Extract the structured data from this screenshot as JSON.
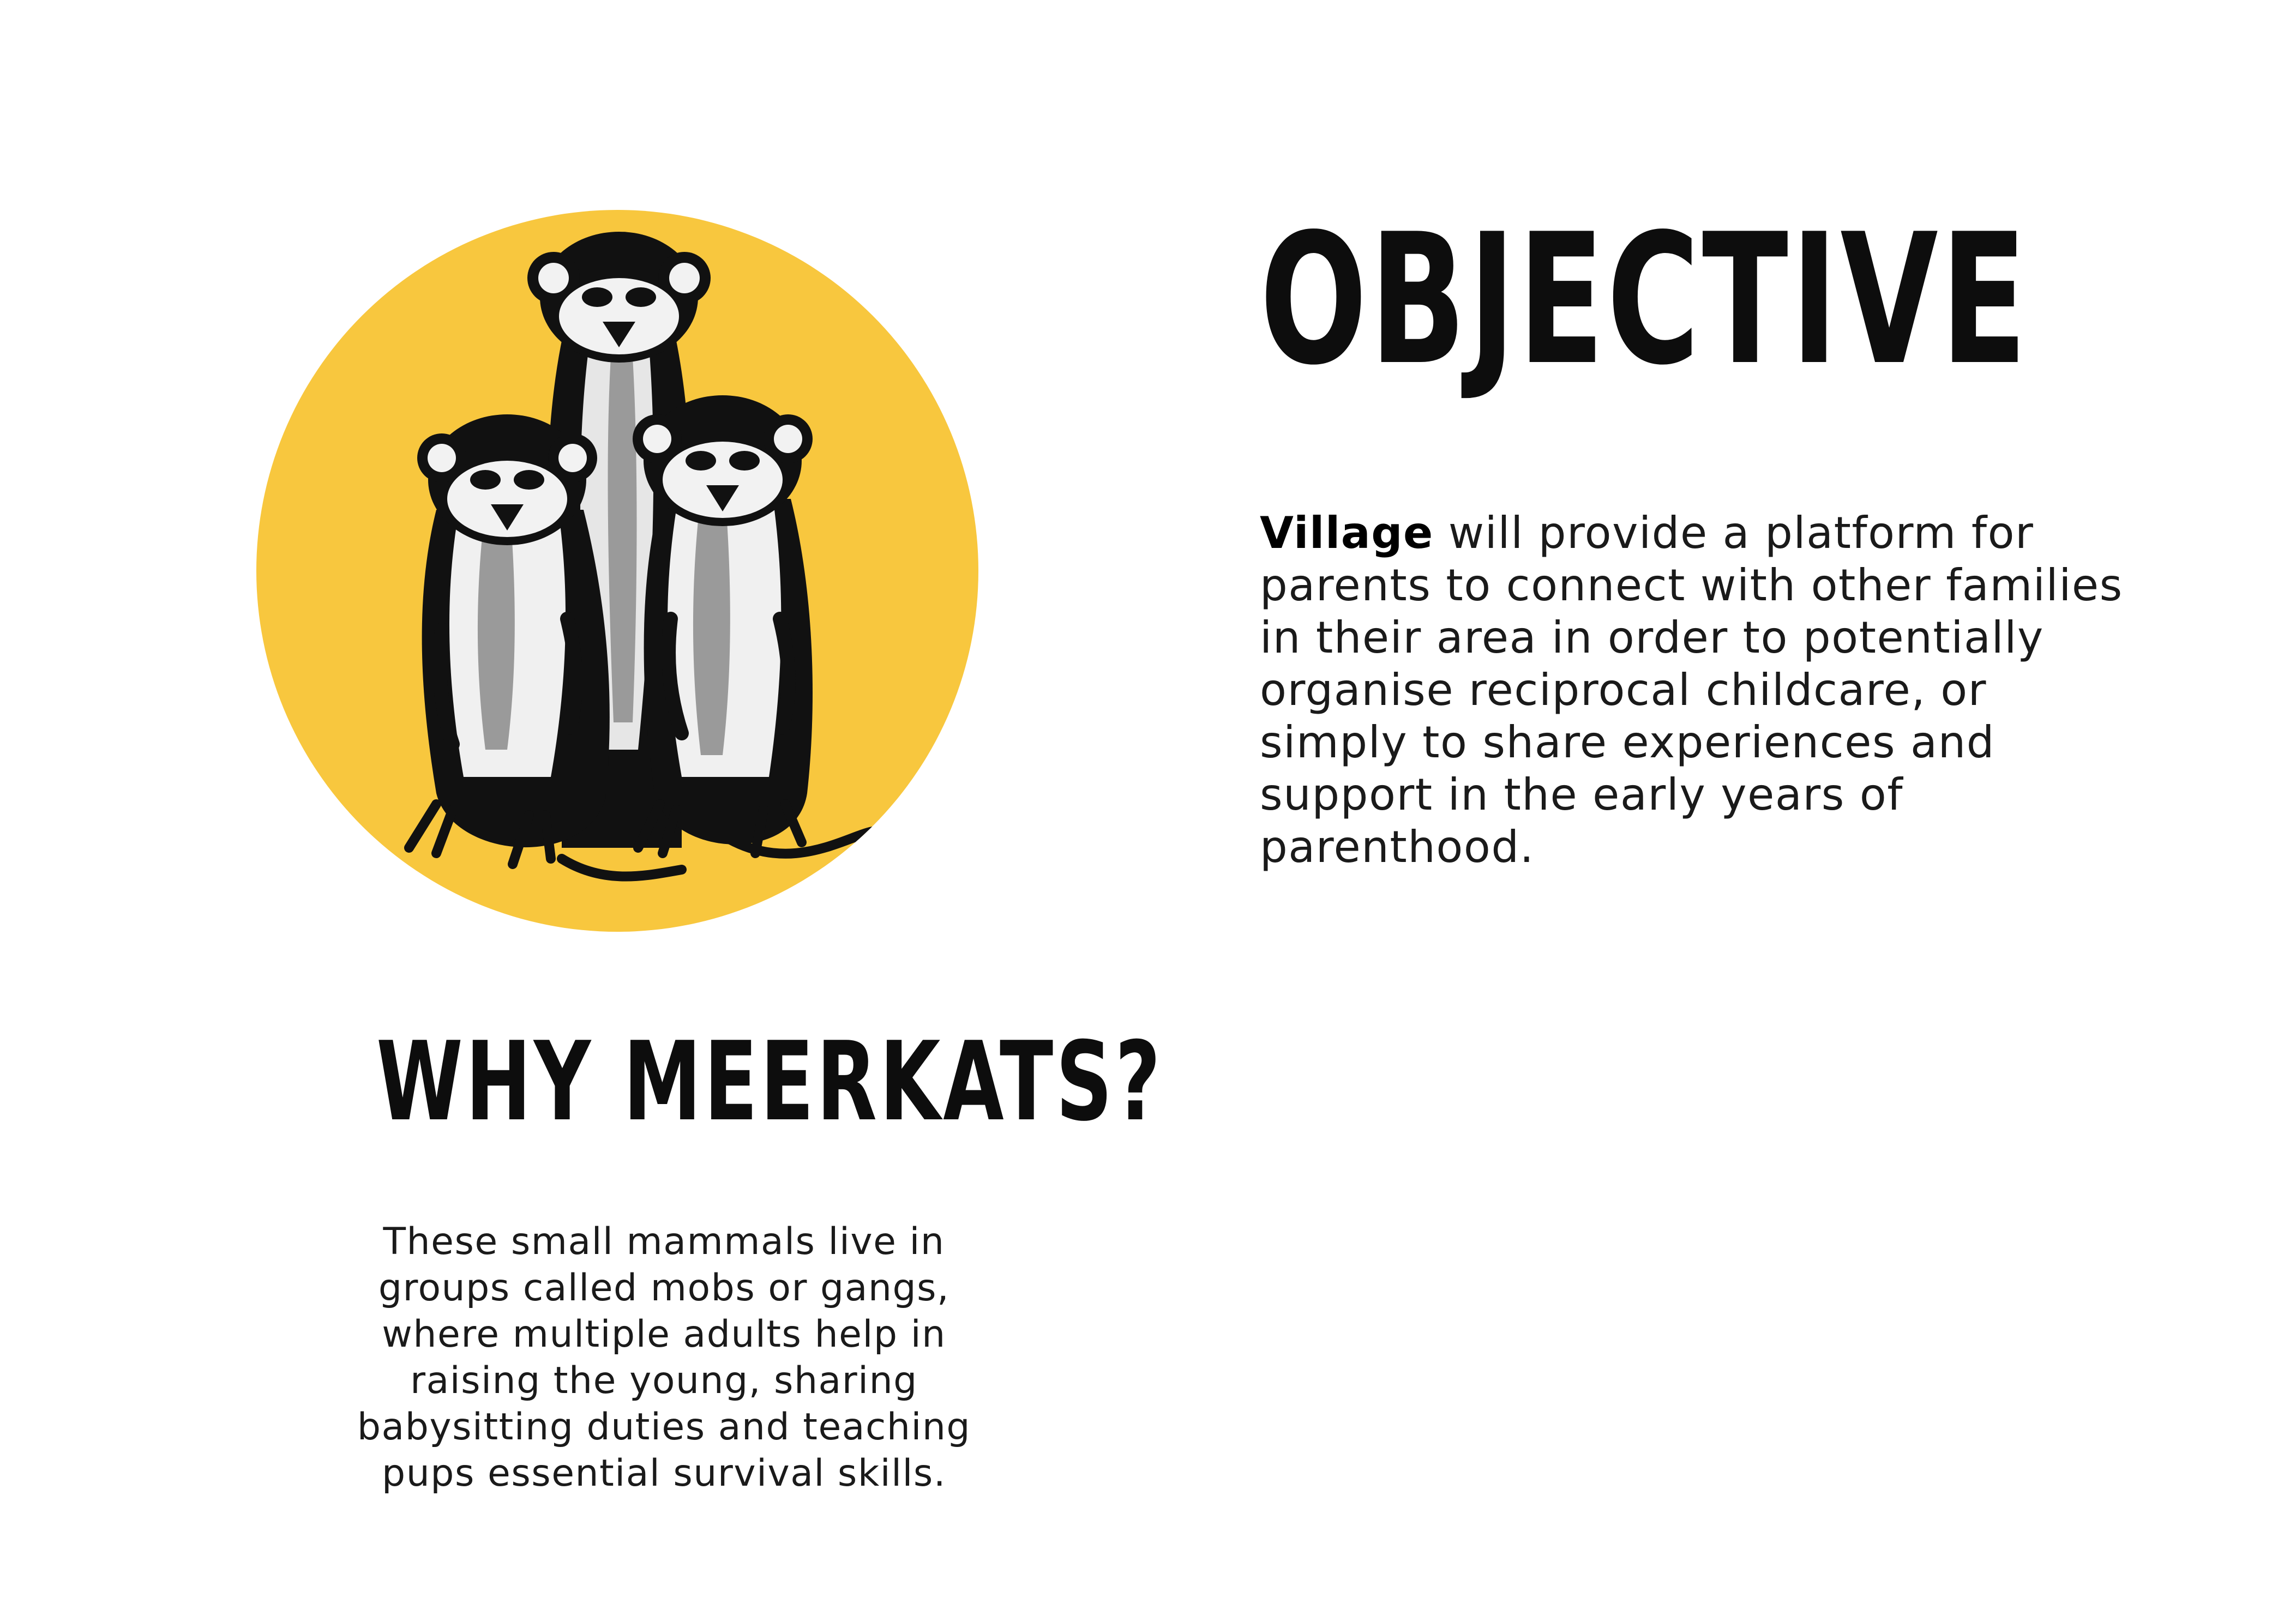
{
  "illustration": {
    "subject": "meerkats",
    "background_color": "#F8C73E"
  },
  "objective": {
    "title": "OBJECTIVE",
    "body_strong": "Village",
    "body_rest": " will provide a platform for parents to connect with other families in their area in order to potentially organise reciprocal childcare, or simply to share experiences and support in the early years of parenthood."
  },
  "why": {
    "title": "WHY MEERKATS?",
    "body": "These small mammals live in groups called mobs or gangs, where multiple adults help in raising the young, sharing babysitting duties and teaching pups essential survival skills."
  }
}
